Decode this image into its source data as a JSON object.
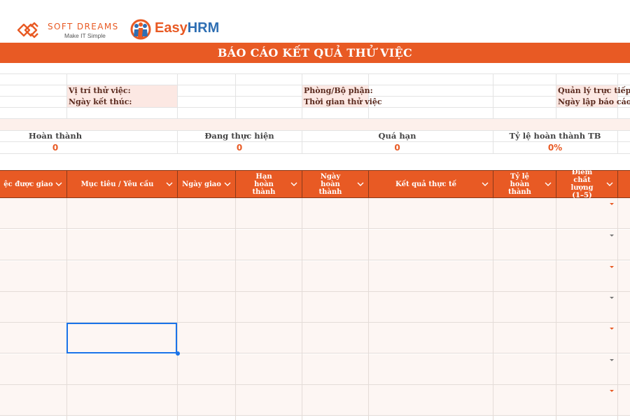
{
  "logos": {
    "softdreams_name": "SOFT DREAMS",
    "softdreams_tagline": "Make IT Simple",
    "easyhrm_easy": "Easy",
    "easyhrm_hrm": "HRM"
  },
  "title": "BÁO CÁO KẾT QUẢ THỬ VIỆC",
  "info": {
    "position_label": "Vị trí thử việc:",
    "end_date_label": "Ngày kết thúc:",
    "department_label": "Phòng/Bộ phận:",
    "probation_time_label": "Thời gian thử việc",
    "manager_label": "Quản lý trực tiếp",
    "report_date_label": "Ngày lập báo cáo"
  },
  "summary": {
    "completed_label": "Hoàn thành",
    "completed_value": "0",
    "in_progress_label": "Đang thực hiện",
    "in_progress_value": "0",
    "overdue_label": "Quá hạn",
    "overdue_value": "0",
    "completion_rate_label": "Tỷ lệ hoàn thành TB",
    "completion_rate_value": "0%"
  },
  "table": {
    "headers": [
      "ệc được giao",
      "Mục tiêu / Yêu cầu",
      "Ngày giao",
      "Hạn hoàn thành",
      "Ngày hoàn thành",
      "Kết quả thực tế",
      "Tỷ lệ hoàn thành",
      "Điểm chất lượng (1–5)"
    ],
    "row_count": 7
  },
  "colors": {
    "accent": "#e85a24",
    "secondary": "#2f6fb3",
    "label_bg": "#fce8e3",
    "row_bg": "#fdf6f3",
    "selection": "#1a73e8"
  },
  "icons": [
    "softdreams-logo-icon",
    "easyhrm-logo-icon",
    "chevron-down-icon",
    "dropdown-arrow-icon"
  ]
}
